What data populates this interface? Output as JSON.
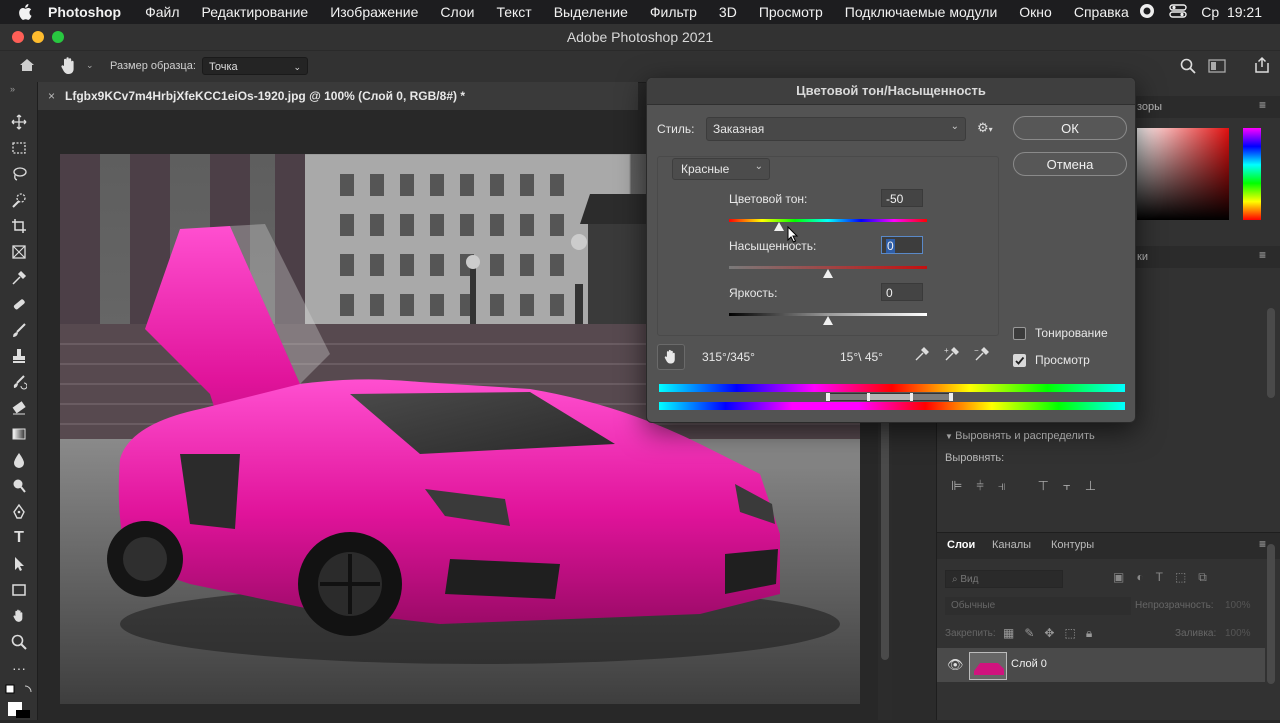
{
  "menubar": {
    "app": "Photoshop",
    "items": [
      "Файл",
      "Редактирование",
      "Изображение",
      "Слои",
      "Текст",
      "Выделение",
      "Фильтр",
      "3D",
      "Просмотр",
      "Подключаемые модули",
      "Окно",
      "Справка"
    ],
    "clock": "Ср  19:21"
  },
  "window": {
    "title": "Adobe Photoshop 2021"
  },
  "options": {
    "sample_label": "Размер образца:",
    "sample_value": "Точка"
  },
  "document": {
    "tab_title": "Lfgbx9KCv7m4HrbjXfeKCC1eiOs-1920.jpg @ 100% (Слой 0, RGB/8#) *"
  },
  "panels": {
    "swatches_tab_partial": "зоры",
    "properties_partial": "ки",
    "align_header": "Выровнять и распределить",
    "align_label": "Выровнять:",
    "layers_tabs": [
      "Слои",
      "Каналы",
      "Контуры"
    ],
    "search_placeholder": "Вид",
    "blend_mode": "Обычные",
    "opacity_label": "Непрозрачность:",
    "opacity_value": "100%",
    "lock_label": "Закрепить:",
    "fill_label": "Заливка:",
    "fill_value": "100%",
    "layer_name": "Слой 0"
  },
  "dialog": {
    "title": "Цветовой тон/Насыщенность",
    "style_label": "Стиль:",
    "style_value": "Заказная",
    "ok": "ОК",
    "cancel": "Отмена",
    "channel": "Красные",
    "hue_label": "Цветовой тон:",
    "hue_value": "-50",
    "hue_level": 0.25,
    "saturation_label": "Насыщенность:",
    "saturation_value": "0",
    "saturation_level": 0.5,
    "lightness_label": "Яркость:",
    "lightness_value": "0",
    "lightness_level": 0.5,
    "colorize_label": "Тонирование",
    "colorize_checked": false,
    "preview_label": "Просмотр",
    "preview_checked": true,
    "range_left": "315°/345°",
    "range_right": "15°\\ 45°"
  },
  "colors": {
    "accent": "#e0139a",
    "dialog_bg": "#535353",
    "ui_bg": "#323232"
  }
}
